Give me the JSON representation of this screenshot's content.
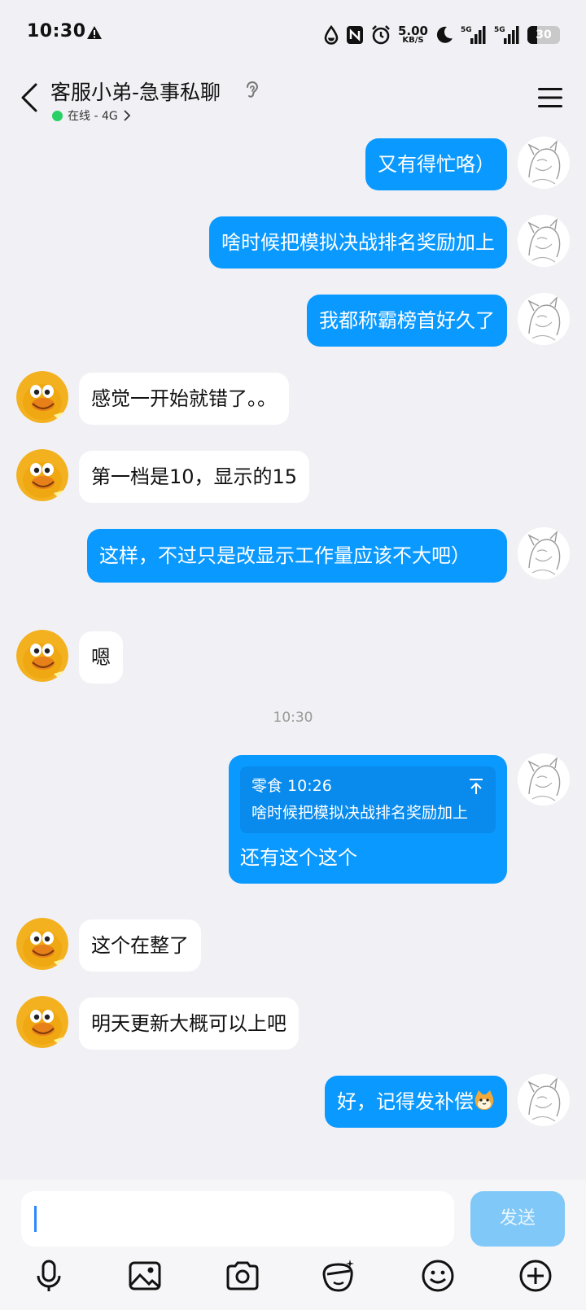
{
  "status_bar": {
    "time": "10:30",
    "net_speed_value": "5.00",
    "net_speed_unit": "KB/S",
    "signal_1": "5G",
    "signal_2": "5G",
    "battery_level": "30"
  },
  "header": {
    "title": "客服小弟-急事私聊",
    "status": "在线 - 4G",
    "online_color": "#29d066"
  },
  "messages": [
    {
      "side": "me",
      "text": "又有得忙咯）"
    },
    {
      "side": "me",
      "text": "啥时候把模拟决战排名奖励加上"
    },
    {
      "side": "me",
      "text": "我都称霸榜首好久了"
    },
    {
      "side": "other",
      "text": "感觉一开始就错了。。"
    },
    {
      "side": "other",
      "text": "第一档是10，显示的15"
    },
    {
      "side": "me",
      "text": "这样，不过只是改显示工作量应该不大吧）"
    },
    {
      "side": "other",
      "text": "嗯"
    },
    {
      "side": "timestamp",
      "text": "10:30"
    },
    {
      "side": "me",
      "quote_meta": "零食 10:26",
      "quote_text": "啥时候把模拟决战排名奖励加上",
      "text": "还有这个这个"
    },
    {
      "side": "other",
      "text": "这个在整了"
    },
    {
      "side": "other",
      "text": "明天更新大概可以上吧"
    },
    {
      "side": "me",
      "text": "好，记得发补偿",
      "emoji": "cat-face-icon"
    }
  ],
  "input": {
    "value": "",
    "send_label": "发送"
  },
  "toolbar": [
    "microphone-icon",
    "image-icon",
    "camera-icon",
    "magic-face-icon",
    "emoji-icon",
    "plus-icon"
  ],
  "colors": {
    "my_bubble": "#0a99ff",
    "other_bubble": "#ffffff",
    "background": "#f1f1f5",
    "send_disabled": "#7fc8f8"
  }
}
